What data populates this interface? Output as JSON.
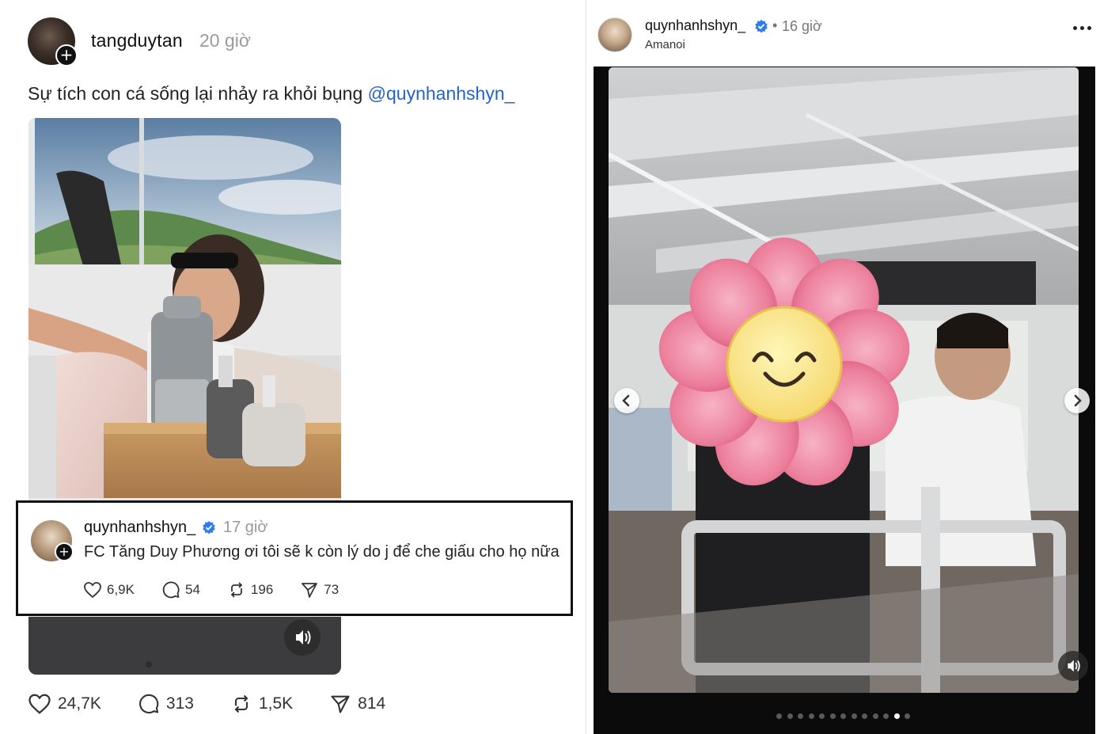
{
  "left_post": {
    "username": "tangduytan",
    "time": "20 giờ",
    "caption": "Sự tích con cá sống lại nhảy ra khỏi bụng ",
    "mention": "@quynhanhshyn_",
    "actions": {
      "likes": "24,7K",
      "comments": "313",
      "reposts": "1,5K",
      "shares": "814"
    }
  },
  "comment": {
    "username": "quynhanhshyn_",
    "time": "17 giờ",
    "text": "FC Tăng Duy Phương ơi tôi sẽ k còn lý do j để che giấu cho họ nữa",
    "actions": {
      "likes": "6,9K",
      "comments": "54",
      "reposts": "196",
      "shares": "73"
    }
  },
  "right_post": {
    "username": "quynhanhshyn_",
    "separator": "•",
    "time": "16 giờ",
    "location": "Amanoi",
    "carousel": {
      "total": 13,
      "active_index": 11
    }
  },
  "colors": {
    "mention": "#2563c9",
    "verified": "#2f7bf2",
    "highlight_border": "#111111"
  }
}
